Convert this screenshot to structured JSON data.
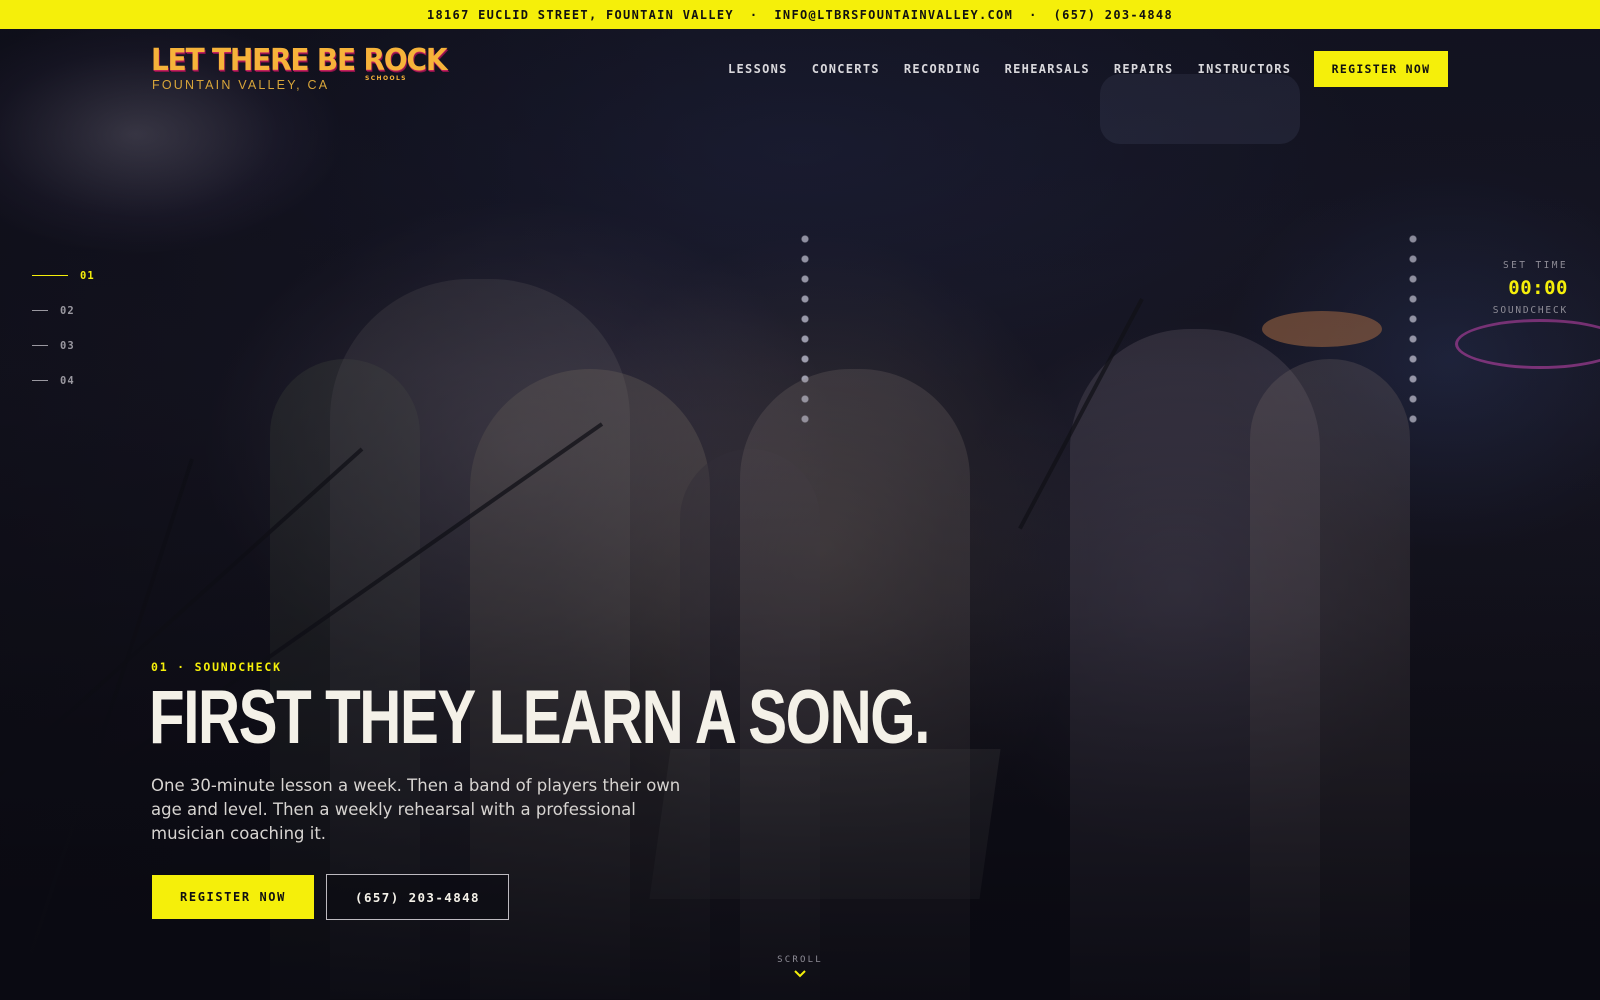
{
  "topbar": {
    "address": "18167 EUCLID STREET, FOUNTAIN VALLEY",
    "separator": "·",
    "email": "INFO@LTBRSFOUNTAINVALLEY.COM",
    "phone": "(657) 203-4848"
  },
  "logo": {
    "name": "LET THERE BE ROCK",
    "schools": "SCHOOLS",
    "location": "FOUNTAIN VALLEY, CA"
  },
  "nav": {
    "items": [
      "LESSONS",
      "CONCERTS",
      "RECORDING",
      "REHEARSALS",
      "REPAIRS",
      "INSTRUCTORS"
    ],
    "cta": "REGISTER NOW"
  },
  "slides": {
    "items": [
      "01",
      "02",
      "03",
      "04"
    ],
    "active": 0
  },
  "settime": {
    "label": "SET TIME",
    "time": "00:00",
    "stage": "SOUNDCHECK"
  },
  "hero": {
    "eyebrow": "01 · SOUNDCHECK",
    "headline": "FIRST THEY LEARN A SONG.",
    "lede": "One 30-minute lesson a week. Then a band of players their own age and level. Then a weekly rehearsal with a professional musician coaching it.",
    "primary_cta": "REGISTER NOW",
    "phone_cta": "(657) 203-4848"
  },
  "scroll": {
    "label": "SCROLL",
    "icon": "chevron-down-icon"
  },
  "colors": {
    "accent": "#f5ef0a",
    "logo_gold": "#f6b33a",
    "logo_magenta": "#c2225e"
  }
}
